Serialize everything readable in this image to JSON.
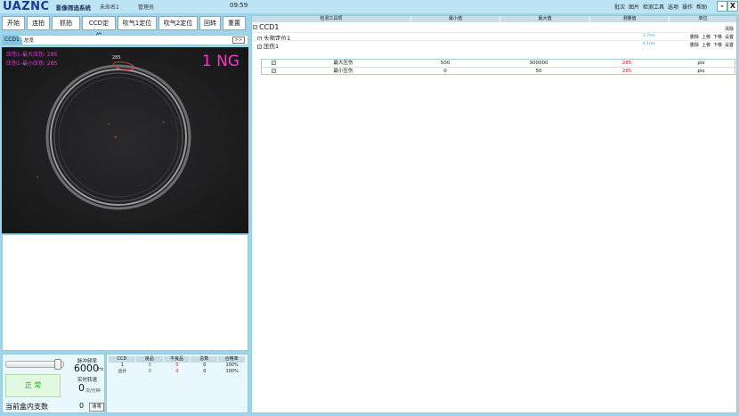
{
  "titlebar": {
    "logo": "UAZNC",
    "app_name": "影像筛选系统",
    "doc_name": "未命名1",
    "user": "管理员",
    "clock": "09:59",
    "menus": [
      "批次",
      "图片",
      "检测工具",
      "选项",
      "操作",
      "帮助"
    ],
    "min_btn": "-",
    "close_btn": "X"
  },
  "toolbar": {
    "buttons": [
      "开始",
      "连拍",
      "抓拍",
      "CCD定位",
      "吹气1定位",
      "吹气2定位",
      "回转",
      "重置"
    ]
  },
  "ccd_tabs": {
    "active": "CCD1",
    "second": "总览",
    "expand": ">>"
  },
  "camera": {
    "overlay_line1": "压伤1-最大压伤: 285",
    "overlay_line2": "压伤1-最小压伤: 285",
    "marker_label": "285",
    "result": "1 NG"
  },
  "status": {
    "pulse_label": "脉冲频率",
    "pulse_value": "6000",
    "pulse_unit": "Hz",
    "speed_label": "实时转速",
    "speed_value": "0",
    "speed_unit": "次/分钟",
    "state": "正 常",
    "count_label": "当前盒内支数",
    "count_value": "0",
    "clear_btn": "清零"
  },
  "stats": {
    "headers": [
      "CCD",
      "良品",
      "不良品",
      "总数",
      "合格率"
    ],
    "rows": [
      [
        "1",
        "0",
        "0",
        "0",
        "100%"
      ],
      [
        "合计",
        "0",
        "0",
        "0",
        "100%"
      ]
    ]
  },
  "tools": {
    "headers": [
      "检测工具项",
      "最小值",
      "最大值",
      "测量值",
      "单位"
    ],
    "root": "CCD1",
    "root_action": "清除",
    "items": [
      {
        "name": "头部定位1",
        "time": "3.7ms",
        "actions": [
          "删除",
          "上移",
          "下移",
          "设置"
        ]
      },
      {
        "name": "压伤1",
        "time": "6.1ms",
        "actions": [
          "删除",
          "上移",
          "下移",
          "设置"
        ]
      }
    ],
    "subrows": [
      {
        "name": "最大压伤",
        "min": "500",
        "max": "300000",
        "value": "285",
        "unit": "pix"
      },
      {
        "name": "最小压伤",
        "min": "0",
        "max": "50",
        "value": "285",
        "unit": "pix"
      }
    ]
  },
  "colors": {
    "accent": "#9fd5ec",
    "ng": "#ff33cc",
    "ok": "#22aa22",
    "fail_value": "#dd1111"
  }
}
